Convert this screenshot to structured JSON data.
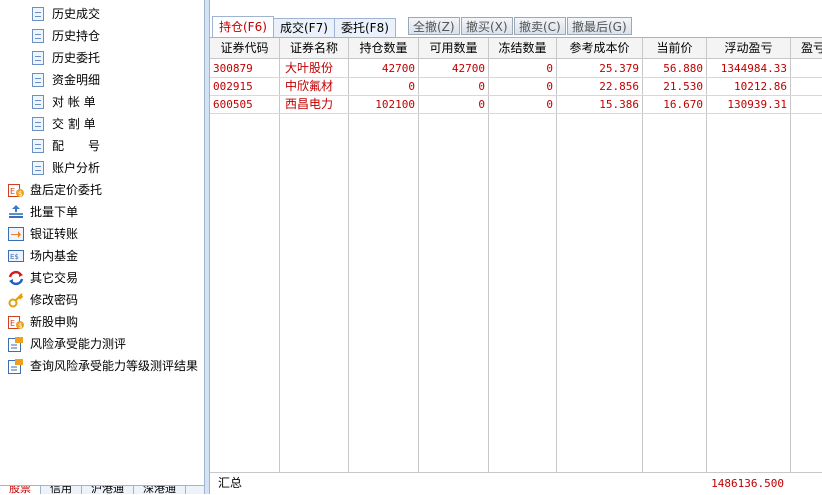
{
  "sidebar": {
    "sub_items": [
      "历史成交",
      "历史持仓",
      "历史委托",
      "资金明细",
      "对 帐 单",
      "交 割 单",
      "配　　号",
      "账户分析"
    ],
    "items": [
      {
        "label": "盘后定价委托",
        "icon": "money-transfer-icon"
      },
      {
        "label": "批量下单",
        "icon": "batch-stack-icon"
      },
      {
        "label": "银证转账",
        "icon": "arrow-transfer-icon"
      },
      {
        "label": "场内基金",
        "icon": "fund-icon"
      },
      {
        "label": "其它交易",
        "icon": "recycle-arrows-icon"
      },
      {
        "label": "修改密码",
        "icon": "key-icon"
      },
      {
        "label": "新股申购",
        "icon": "money-transfer-icon"
      },
      {
        "label": "风险承受能力测评",
        "icon": "flag-doc-icon"
      },
      {
        "label": "查询风险承受能力等级测评结果",
        "icon": "flag-doc-icon"
      }
    ],
    "bottom_tabs": [
      "股票",
      "信用",
      "沪港通",
      "深港通"
    ]
  },
  "tabs": [
    {
      "label": "持仓(F6)",
      "active": true
    },
    {
      "label": "成交(F7)",
      "active": false
    },
    {
      "label": "委托(F8)",
      "active": false
    }
  ],
  "toolbar": [
    "全撤(Z)",
    "撤买(X)",
    "撤卖(C)",
    "撤最后(G)"
  ],
  "table": {
    "columns": [
      "证券代码",
      "证券名称",
      "持仓数量",
      "可用数量",
      "冻结数量",
      "参考成本价",
      "当前价",
      "浮动盈亏",
      "盈亏"
    ],
    "rows": [
      [
        "300879",
        "大叶股份",
        "42700",
        "42700",
        "0",
        "25.379",
        "56.880",
        "1344984.33"
      ],
      [
        "002915",
        "中欣氟材",
        "0",
        "0",
        "0",
        "22.856",
        "21.530",
        "10212.86"
      ],
      [
        "600505",
        "西昌电力",
        "102100",
        "0",
        "0",
        "15.386",
        "16.670",
        "130939.31"
      ]
    ],
    "summary_label": "汇总",
    "summary_value": "1486136.500"
  },
  "colors": {
    "accent": "#c00000",
    "border": "#9fb4d3"
  }
}
